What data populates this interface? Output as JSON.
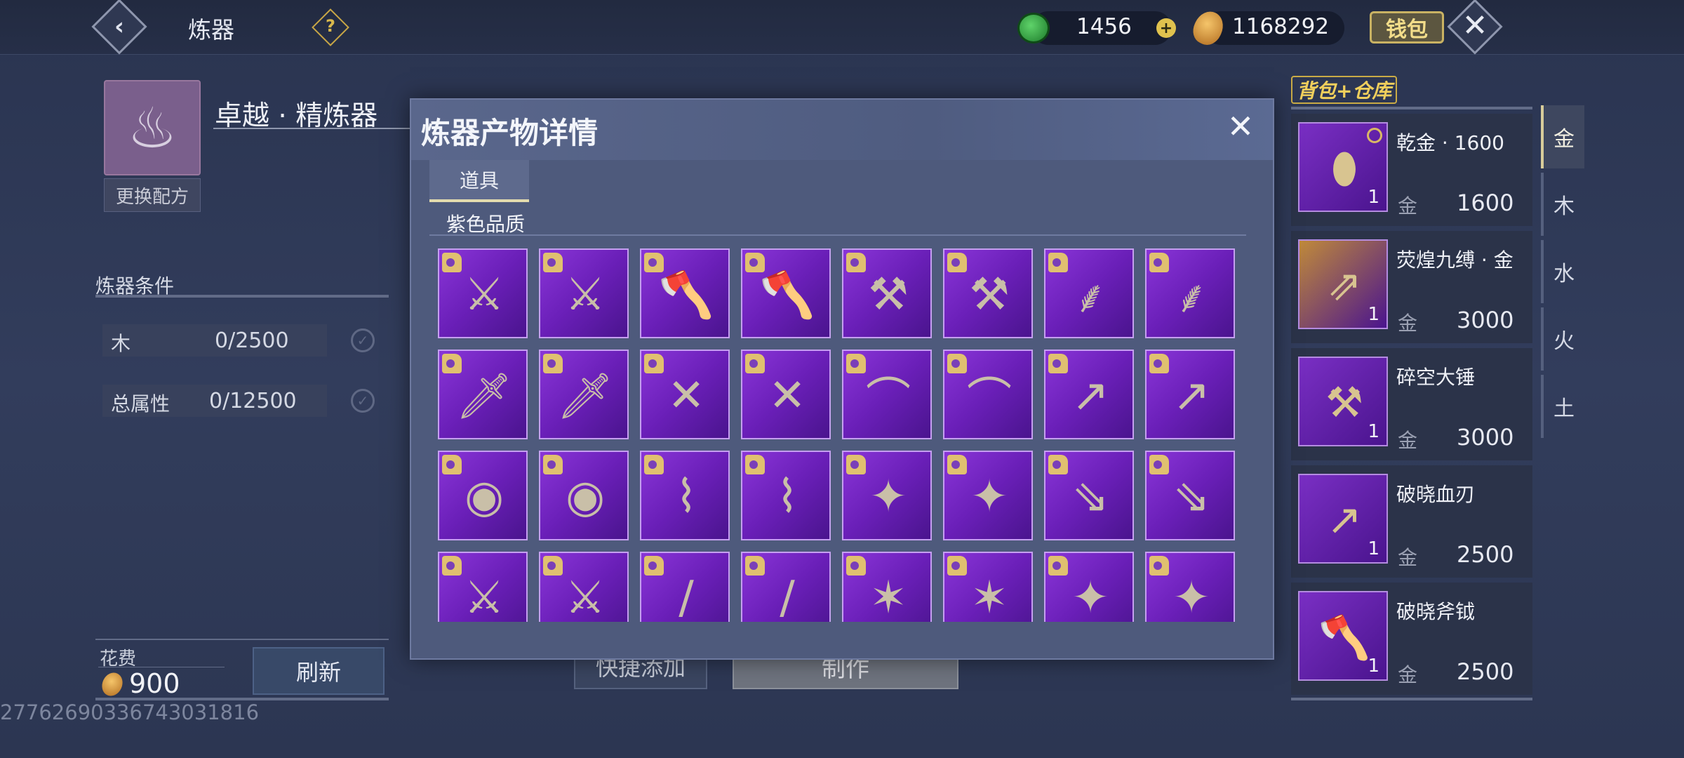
{
  "topbar": {
    "title": "炼器",
    "help_glyph": "?",
    "back_glyph": "‹",
    "jade_value": "1456",
    "gold_value": "1168292",
    "wallet_label": "钱包",
    "close_glyph": "✕"
  },
  "left": {
    "recipe_name": "卓越 · 精炼器",
    "swap_label": "更换配方",
    "conditions_title": "炼器条件",
    "conditions": [
      {
        "label": "木",
        "value": "0/2500"
      },
      {
        "label": "总属性",
        "value": "0/12500"
      }
    ],
    "cost_label": "花费",
    "cost_value": "900",
    "refresh_label": "刷新",
    "uid": "2776269033674303181​6"
  },
  "actions": {
    "quick_add_label": "快捷添加",
    "make_label": "制作"
  },
  "modal": {
    "title": "炼器产物详情",
    "close_glyph": "✕",
    "tab_label": "道具",
    "grade_label": "紫色品质",
    "items": [
      {
        "icon": "twin-swords-icon",
        "glyph": "⚔"
      },
      {
        "icon": "twin-swords-icon",
        "glyph": "⚔"
      },
      {
        "icon": "battle-axe-icon",
        "glyph": "🪓"
      },
      {
        "icon": "battle-axe-icon",
        "glyph": "🪓"
      },
      {
        "icon": "great-hammer-icon",
        "glyph": "⚒"
      },
      {
        "icon": "great-hammer-icon",
        "glyph": "⚒"
      },
      {
        "icon": "curved-blade-icon",
        "glyph": "⸙"
      },
      {
        "icon": "curved-blade-icon",
        "glyph": "⸙"
      },
      {
        "icon": "dagger-icon",
        "glyph": "🗡"
      },
      {
        "icon": "dagger-icon",
        "glyph": "🗡"
      },
      {
        "icon": "crossed-blades-icon",
        "glyph": "✕"
      },
      {
        "icon": "crossed-blades-icon",
        "glyph": "✕"
      },
      {
        "icon": "scimitar-icon",
        "glyph": "⌒"
      },
      {
        "icon": "scimitar-icon",
        "glyph": "⌒"
      },
      {
        "icon": "blood-blade-icon",
        "glyph": "↗"
      },
      {
        "icon": "blood-blade-icon",
        "glyph": "↗"
      },
      {
        "icon": "round-shield-icon",
        "glyph": "◉"
      },
      {
        "icon": "round-shield-icon",
        "glyph": "◉"
      },
      {
        "icon": "bow-icon",
        "glyph": "⌇"
      },
      {
        "icon": "bow-icon",
        "glyph": "⌇"
      },
      {
        "icon": "ornate-staff-icon",
        "glyph": "✦"
      },
      {
        "icon": "ornate-staff-icon",
        "glyph": "✦"
      },
      {
        "icon": "arrows-icon",
        "glyph": "⇘"
      },
      {
        "icon": "arrows-icon",
        "glyph": "⇘"
      },
      {
        "icon": "twin-pistols-icon",
        "glyph": "⚔"
      },
      {
        "icon": "twin-pistols-icon",
        "glyph": "⚔"
      },
      {
        "icon": "flute-icon",
        "glyph": "/"
      },
      {
        "icon": "flute-icon",
        "glyph": "/"
      },
      {
        "icon": "mace-icon",
        "glyph": "✶"
      },
      {
        "icon": "mace-icon",
        "glyph": "✶"
      },
      {
        "icon": "shuriken-icon",
        "glyph": "✦"
      },
      {
        "icon": "shuriken-icon",
        "glyph": "✦"
      }
    ]
  },
  "bag": {
    "title": "背包+仓库",
    "items": [
      {
        "name": "乾金 · 1600",
        "element": "金",
        "value": "1600",
        "qty": "1",
        "icon": "gold-ore-icon",
        "glyph": "⬮",
        "bg": "#7a2fc4"
      },
      {
        "name": "荧煌九缚 · 金",
        "element": "金",
        "value": "3000",
        "qty": "1",
        "icon": "arrow-bundle-icon",
        "glyph": "⇗",
        "bg": "#c08a3a"
      },
      {
        "name": "碎空大锤",
        "element": "金",
        "value": "3000",
        "qty": "1",
        "icon": "great-hammer-icon",
        "glyph": "⚒",
        "bg": "#7a2fc4"
      },
      {
        "name": "破晓血刃",
        "element": "金",
        "value": "2500",
        "qty": "1",
        "icon": "blood-blade-icon",
        "glyph": "↗",
        "bg": "#7a2fc4"
      },
      {
        "name": "破晓斧钺",
        "element": "金",
        "value": "2500",
        "qty": "1",
        "icon": "battle-axe-icon",
        "glyph": "🪓",
        "bg": "#7a2fc4"
      }
    ],
    "element_tabs": [
      "金",
      "木",
      "水",
      "火",
      "土"
    ]
  }
}
